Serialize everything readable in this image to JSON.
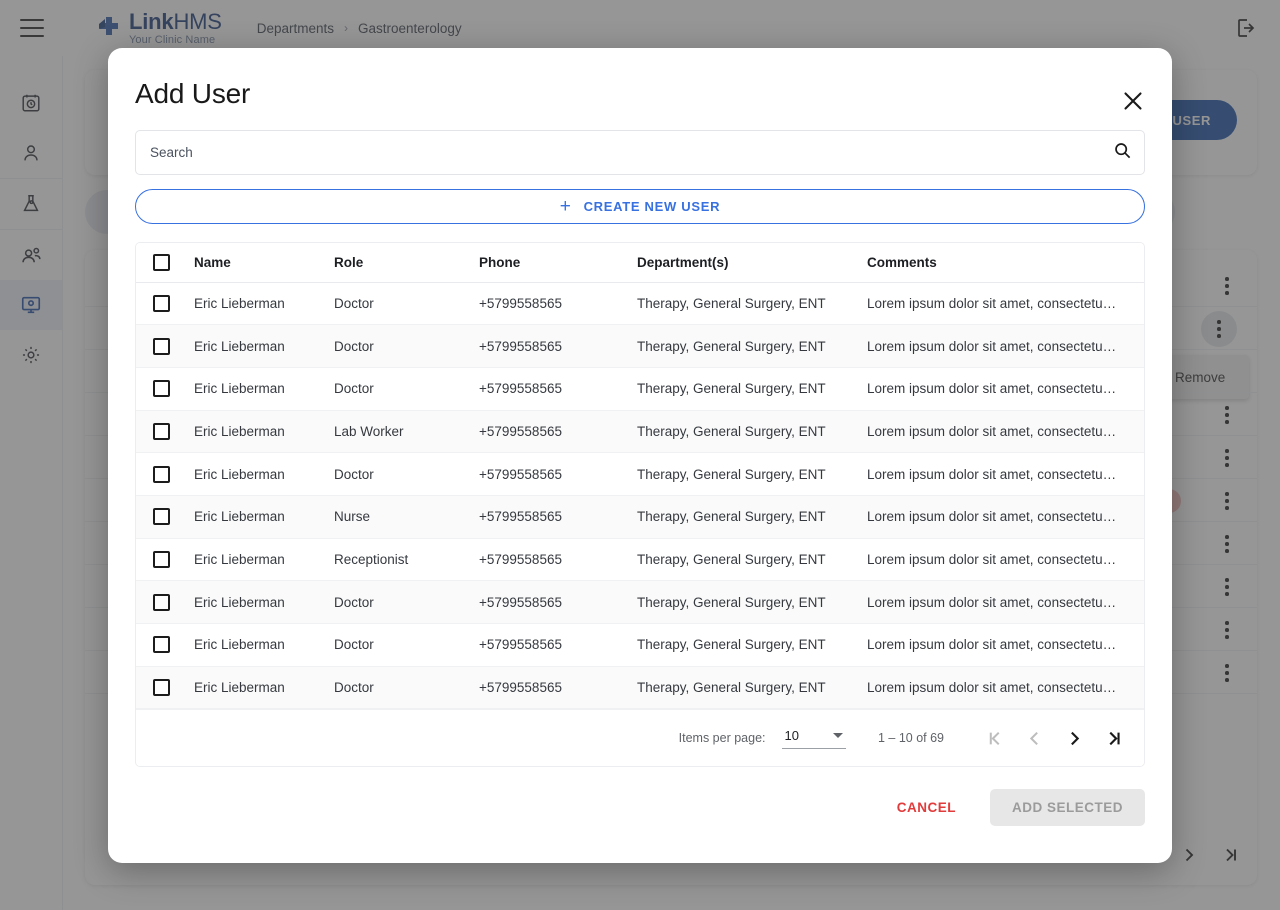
{
  "topbar": {
    "menu_icon": "hamburger-icon",
    "logo_bold": "Link",
    "logo_light": "HMS",
    "logo_subtitle": "Your Clinic Name",
    "breadcrumb": [
      "Departments",
      "Gastroenterology"
    ],
    "breadcrumb_separator": "›",
    "logout_icon": "logout-icon"
  },
  "sidebar": {
    "items": [
      {
        "name": "appointments",
        "icon": "calendar-clock-icon",
        "active": false
      },
      {
        "name": "patients",
        "icon": "person-icon",
        "active": false
      },
      {
        "name": "laboratory",
        "icon": "lab-flask-icon",
        "active": false
      },
      {
        "name": "staff",
        "icon": "people-group-icon",
        "active": false
      },
      {
        "name": "departments",
        "icon": "monitor-icon",
        "active": true
      },
      {
        "name": "settings",
        "icon": "gear-icon",
        "active": false
      }
    ]
  },
  "background": {
    "assign_user_label": "ASSIGN USER",
    "remove_menu_label": "Remove",
    "accent_blue": "#1b52a8"
  },
  "modal": {
    "title": "Add User",
    "close_icon": "close-icon",
    "search": {
      "placeholder": "Search",
      "value": "",
      "icon": "search-icon"
    },
    "create_new_user": {
      "label": "CREATE NEW USER",
      "plus_icon": "plus-icon"
    },
    "table": {
      "columns": [
        "Name",
        "Role",
        "Phone",
        "Department(s)",
        "Comments"
      ],
      "select_all_checked": false,
      "rows": [
        {
          "checked": false,
          "name": "Eric Lieberman",
          "role": "Doctor",
          "phone": "+5799558565",
          "departments": "Therapy, General Surgery, ENT",
          "comments": "Lorem ipsum dolor sit amet, consectetu…"
        },
        {
          "checked": false,
          "name": "Eric Lieberman",
          "role": "Doctor",
          "phone": "+5799558565",
          "departments": "Therapy, General Surgery, ENT",
          "comments": "Lorem ipsum dolor sit amet, consectetu…"
        },
        {
          "checked": false,
          "name": "Eric Lieberman",
          "role": "Doctor",
          "phone": "+5799558565",
          "departments": "Therapy, General Surgery, ENT",
          "comments": "Lorem ipsum dolor sit amet, consectetu…"
        },
        {
          "checked": false,
          "name": "Eric Lieberman",
          "role": "Lab Worker",
          "phone": "+5799558565",
          "departments": "Therapy, General Surgery, ENT",
          "comments": "Lorem ipsum dolor sit amet, consectetu…"
        },
        {
          "checked": false,
          "name": "Eric Lieberman",
          "role": "Doctor",
          "phone": "+5799558565",
          "departments": "Therapy, General Surgery, ENT",
          "comments": "Lorem ipsum dolor sit amet, consectetu…"
        },
        {
          "checked": false,
          "name": "Eric Lieberman",
          "role": "Nurse",
          "phone": "+5799558565",
          "departments": "Therapy, General Surgery, ENT",
          "comments": "Lorem ipsum dolor sit amet, consectetu…"
        },
        {
          "checked": false,
          "name": "Eric Lieberman",
          "role": "Receptionist",
          "phone": "+5799558565",
          "departments": "Therapy, General Surgery, ENT",
          "comments": "Lorem ipsum dolor sit amet, consectetu…"
        },
        {
          "checked": false,
          "name": "Eric Lieberman",
          "role": "Doctor",
          "phone": "+5799558565",
          "departments": "Therapy, General Surgery, ENT",
          "comments": "Lorem ipsum dolor sit amet, consectetu…"
        },
        {
          "checked": false,
          "name": "Eric Lieberman",
          "role": "Doctor",
          "phone": "+5799558565",
          "departments": "Therapy, General Surgery, ENT",
          "comments": "Lorem ipsum dolor sit amet, consectetu…"
        },
        {
          "checked": false,
          "name": "Eric Lieberman",
          "role": "Doctor",
          "phone": "+5799558565",
          "departments": "Therapy, General Surgery, ENT",
          "comments": "Lorem ipsum dolor sit amet, consectetu…"
        }
      ]
    },
    "pagination": {
      "items_per_page_label": "Items per page:",
      "items_per_page_value": "10",
      "range_label": "1 – 10 of 69",
      "first_icon": "first-page-icon",
      "prev_icon": "previous-page-icon",
      "next_icon": "next-page-icon",
      "last_icon": "last-page-icon",
      "first_enabled": false,
      "prev_enabled": false,
      "next_enabled": true,
      "last_enabled": true
    },
    "footer": {
      "cancel_label": "CANCEL",
      "add_selected_label": "ADD SELECTED",
      "add_selected_enabled": false,
      "cancel_color": "#e23b3b"
    }
  }
}
